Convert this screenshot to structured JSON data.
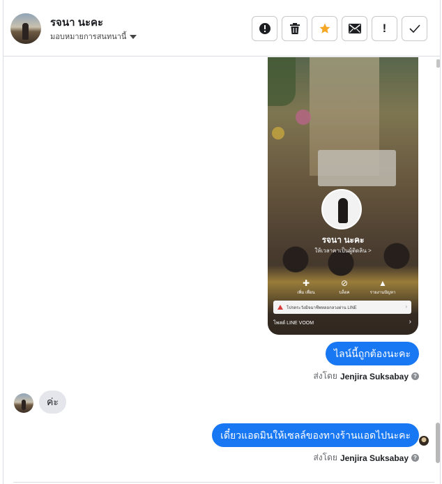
{
  "contact": {
    "name": "รจนา นะคะ",
    "assign_label": "มอบหมายการสนทนานี้"
  },
  "toolbar": {
    "buttons": [
      {
        "name": "report-button",
        "icon": "alert-circle-icon"
      },
      {
        "name": "delete-button",
        "icon": "trash-icon"
      },
      {
        "name": "star-button",
        "icon": "star-icon",
        "color": "#f5a623"
      },
      {
        "name": "mark-unread-button",
        "icon": "envelope-icon"
      },
      {
        "name": "spam-button",
        "icon": "exclamation-icon",
        "label": "!"
      },
      {
        "name": "done-button",
        "icon": "check-icon"
      }
    ]
  },
  "shared_image": {
    "profile_name": "รจนา นะคะ",
    "profile_sub": "ให้เวลาคาเป็นผู้ติดลิน >",
    "actions": [
      {
        "label": "เพิ่ม เพื่อน",
        "icon": "add-friend-icon"
      },
      {
        "label": "บล็อค",
        "icon": "block-icon"
      },
      {
        "label": "รายงานปัญหา",
        "icon": "bell-icon"
      }
    ],
    "alert_text": "โปรดระวังมิจฉาชีพหลอกลวงผ่าน LINE",
    "footer": "โพสต์ LINE VOOM"
  },
  "messages": [
    {
      "direction": "out",
      "text": "ไลน์นี้ถูกต้องนะคะ",
      "sent_by_label": "ส่งโดย",
      "sent_by_name": "Jenjira Suksabay"
    },
    {
      "direction": "in",
      "text": "ค่ะ"
    },
    {
      "direction": "out",
      "text": "เดี๋ยวแอดมินให้เซลล์ของทางร้านแอดไปนะคะ",
      "sent_by_label": "ส่งโดย",
      "sent_by_name": "Jenjira Suksabay"
    }
  ],
  "colors": {
    "accent": "#1877f2",
    "incoming_bubble": "#e4e6eb",
    "star": "#f5a623"
  }
}
